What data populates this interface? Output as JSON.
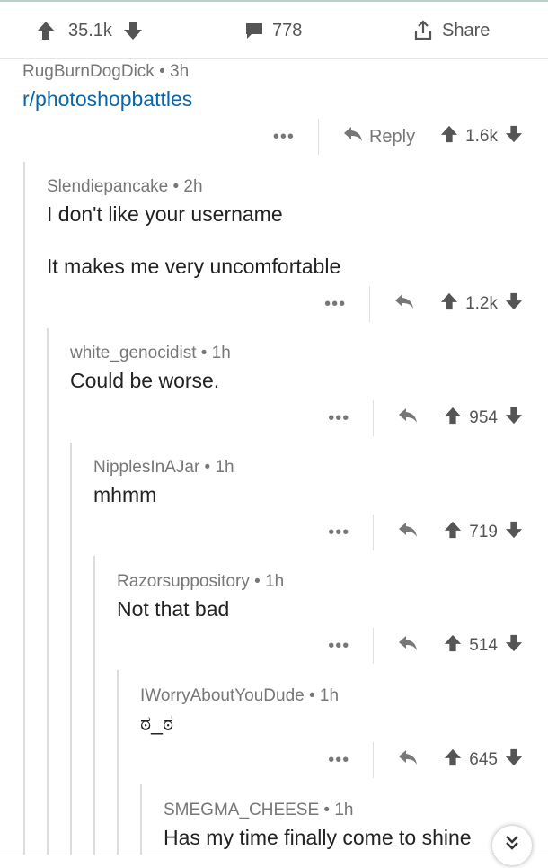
{
  "topbar": {
    "upvotes": "35.1k",
    "comments": "778",
    "share_label": "Share"
  },
  "parent": {
    "meta": "RugBurnDogDick • 3h",
    "subreddit": "r/photoshopbattles",
    "reply_label": "Reply",
    "votes": "1.6k"
  },
  "comments": [
    {
      "meta": "Slendiepancake • 2h",
      "body": "I don't like your username\n\nIt makes me very uncomfortable",
      "votes": "1.2k"
    },
    {
      "meta": "white_genocidist • 1h",
      "body": "Could be worse.",
      "votes": "954"
    },
    {
      "meta": "NipplesInAJar • 1h",
      "body": "mhmm",
      "votes": "719"
    },
    {
      "meta": "Razorsuppository • 1h",
      "body": "Not that bad",
      "votes": "514"
    },
    {
      "meta": "IWorryAboutYouDude • 1h",
      "body": "ಠ_ಠ",
      "votes": "645"
    },
    {
      "meta": "SMEGMA_CHEESE • 1h",
      "body": "Has my time finally come to shine"
    }
  ],
  "icons": {
    "upvote": "arrow-up-icon",
    "downvote": "arrow-down-icon",
    "comment": "comment-bubble-icon",
    "share": "share-upload-icon",
    "reply": "reply-arrow-icon",
    "more": "more-dots-icon",
    "collapse": "double-chevron-down-icon"
  }
}
